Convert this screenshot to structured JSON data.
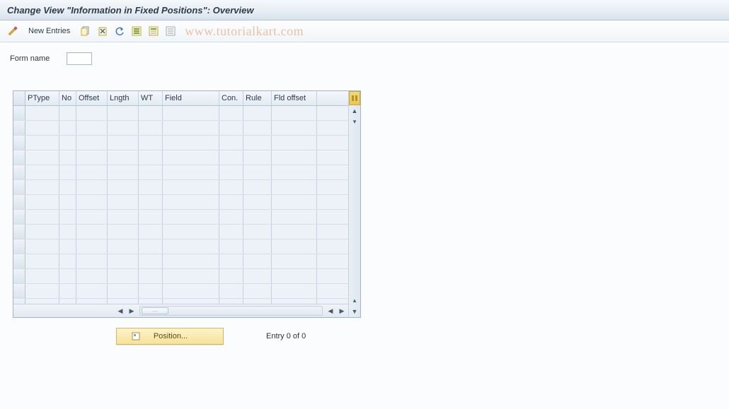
{
  "titlebar": {
    "text": "Change View \"Information in Fixed Positions\": Overview"
  },
  "toolbar": {
    "new_entries_label": "New Entries",
    "watermark": "www.tutorialkart.com"
  },
  "form": {
    "name_label": "Form name",
    "name_value": ""
  },
  "grid": {
    "columns": [
      "PType",
      "No",
      "Offset",
      "Lngth",
      "WT",
      "Field",
      "Con.",
      "Rule",
      "Fld offset"
    ],
    "row_count": 14
  },
  "footer": {
    "position_label": "Position...",
    "entry_text": "Entry 0 of 0"
  }
}
